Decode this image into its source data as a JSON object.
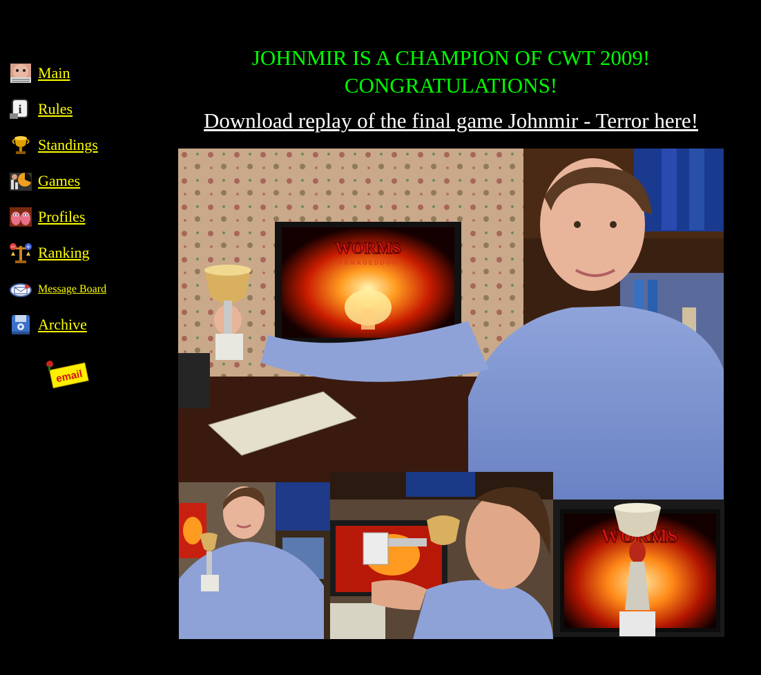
{
  "nav": {
    "items": [
      {
        "label": "Main",
        "icon": "face-icon"
      },
      {
        "label": "Rules",
        "icon": "info-icon"
      },
      {
        "label": "Standings",
        "icon": "trophy-icon"
      },
      {
        "label": "Games",
        "icon": "games-icon"
      },
      {
        "label": "Profiles",
        "icon": "worms-icon"
      },
      {
        "label": "Ranking",
        "icon": "scale-icon"
      },
      {
        "label": "Message Board",
        "icon": "message-icon"
      },
      {
        "label": "Archive",
        "icon": "floppy-icon"
      }
    ],
    "email_label": "email"
  },
  "main": {
    "headline_line1": "JOHNMIR IS A CHAMPION OF CWT 2009!",
    "headline_line2": "CONGRATULATIONS!",
    "download_link": "Download replay of the final game Johnmir - Terror here!"
  },
  "photos": {
    "main_photo_logo": "WORMS",
    "main_photo_sub": "ARMAGEDDON",
    "cup_photo_logo": "WORMS"
  },
  "colors": {
    "background": "#000000",
    "nav_link": "#ffff00",
    "headline": "#00ff00",
    "download_link": "#ffffff"
  }
}
